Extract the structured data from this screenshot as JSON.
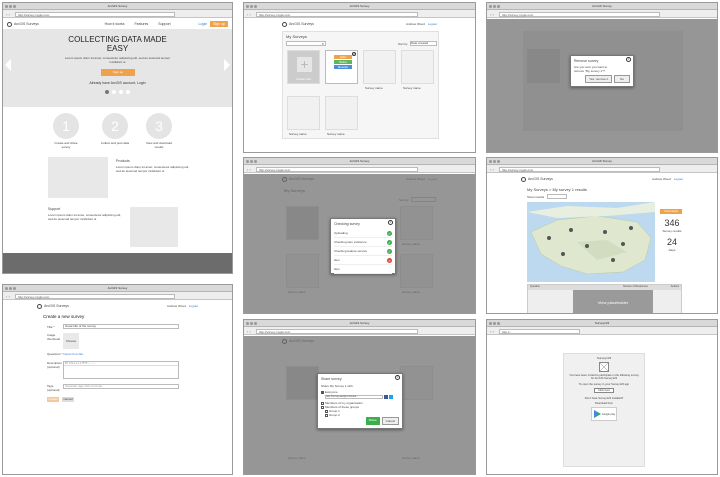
{
  "w1": {
    "title": "ArcGIS Survey",
    "url": "http://survey.mygis.com",
    "brand": "ArcGIS Surveys",
    "nav": [
      "How it works",
      "Features",
      "Support"
    ],
    "login": "Login",
    "signup": "Sign up",
    "hero_title": "COLLECTING DATA MADE EASY",
    "hero_text": "Lorem ipsum dolor sit amet, consectetur adipiscing elit, sed do eiusmod tempor incididunt ut",
    "hero_btn": "Sign up",
    "have_account": "Already have ArcGIS account, Login",
    "steps": [
      {
        "num": "1",
        "label": "Create and share survey"
      },
      {
        "num": "2",
        "label": "Collect and post data"
      },
      {
        "num": "3",
        "label": "View and download results"
      }
    ],
    "products_title": "Products",
    "products_text": "Lorem ipsum dolor sit amet, consectetur adipiscing elit, sed do eiusmod tempor incididunt ut",
    "support_title": "Support",
    "support_text": "Lorem ipsum dolor sit amet, consectetur adipiscing elit, sed do eiusmod tempor incididunt ut"
  },
  "w2": {
    "title": "ArcGIS Survey",
    "url": "http://survey.mygis.com",
    "brand": "ArcGIS Surveys",
    "user": "Andrew Wood",
    "logout": "Logout",
    "my_surveys": "My Surveys",
    "sort": "Sort by",
    "sort_value": "Date created",
    "create": "Create new",
    "menu": [
      "Edit",
      "Share",
      "Results"
    ],
    "tiles": [
      "Survey name",
      "Survey name",
      "Survey name",
      "Survey name",
      "Survey name",
      "Survey name"
    ]
  },
  "w3": {
    "title": "ArcGIS Survey",
    "url": "http://survey.mygis.com",
    "dlg_title": "Remove survey",
    "dlg_text": "Are you sure you want to remove \"My survey 1\"?",
    "yes": "Yes, remove it",
    "no": "No"
  },
  "w4": {
    "title": "ArcGIS Survey",
    "url": "http://survey.mygis.com",
    "brand": "ArcGIS Surveys",
    "user": "Andrew Wood",
    "logout": "Logout",
    "my_surveys": "My Surveys",
    "sort": "Sort by",
    "dlg_title": "Checking survey",
    "checks": [
      {
        "label": "Uploading",
        "ok": true
      },
      {
        "label": "Checking item existence",
        "ok": true
      },
      {
        "label": "Checking feature service",
        "ok": true
      },
      {
        "label": "Item",
        "ok": false
      },
      {
        "label": "Item",
        "ok": true
      }
    ],
    "tiles": [
      "Survey name",
      "Survey name",
      "Survey name"
    ]
  },
  "w5": {
    "title": "ArcGIS Survey",
    "url": "http://survey.mygis.com",
    "brand": "ArcGIS Surveys",
    "user": "Andrew Wood",
    "logout": "Logout",
    "heading": "My Surveys > My survey 1 results",
    "show_results": "Show results",
    "download": "Download",
    "stat1_num": "346",
    "stat1_label": "Survey results",
    "stat2_num": "24",
    "stat2_label": "Days",
    "placeholder": "View placeholder",
    "table_header": [
      "Question",
      "Number of Responses",
      "Actions"
    ]
  },
  "w6": {
    "title": "ArcGIS Survey",
    "url": "http://survey.mygis.com",
    "brand": "ArcGIS Surveys",
    "user": "Andrew Wood",
    "logout": "Logout",
    "heading": "Create a new survey",
    "title_label": "Title *",
    "title_value": "Great title of the survey",
    "image_label": "Image thumbnail",
    "image_btn": "Choose",
    "questions_label": "Questions *",
    "questions_link": "Import from file",
    "desc_label": "Description (optional)",
    "tags_label": "Tags (optional)",
    "tags_value": "Separate tags with commas",
    "create_btn": "Create",
    "cancel_btn": "Cancel"
  },
  "w7": {
    "title": "ArcGIS Survey",
    "url": "http://survey.mygis.com",
    "brand": "ArcGIS Surveys",
    "dlg_title": "Share survey",
    "share_with": "Share My Survey 1 with:",
    "everyone": "Everyone",
    "link_value": "http://survey.arcgis.com/sur...",
    "members_org": "Members of my organization",
    "members_groups": "Members of these groups",
    "groups": [
      "Group 1",
      "Group 2"
    ],
    "share_btn": "Share",
    "cancel_btn": "Cancel",
    "tiles": [
      "Survey name",
      "Survey name"
    ]
  },
  "w8": {
    "title": "Survey123",
    "url": "http://...",
    "card_title": "Survey123",
    "card_text": "You have been invited to participate in the following survey for ArcGIS Survey123",
    "open_text": "To open the survey in your Survey123 app",
    "open_btn": "Click here",
    "download_text": "Don't have Survey123 installed?",
    "download_label": "Download from",
    "store": "Google play"
  }
}
